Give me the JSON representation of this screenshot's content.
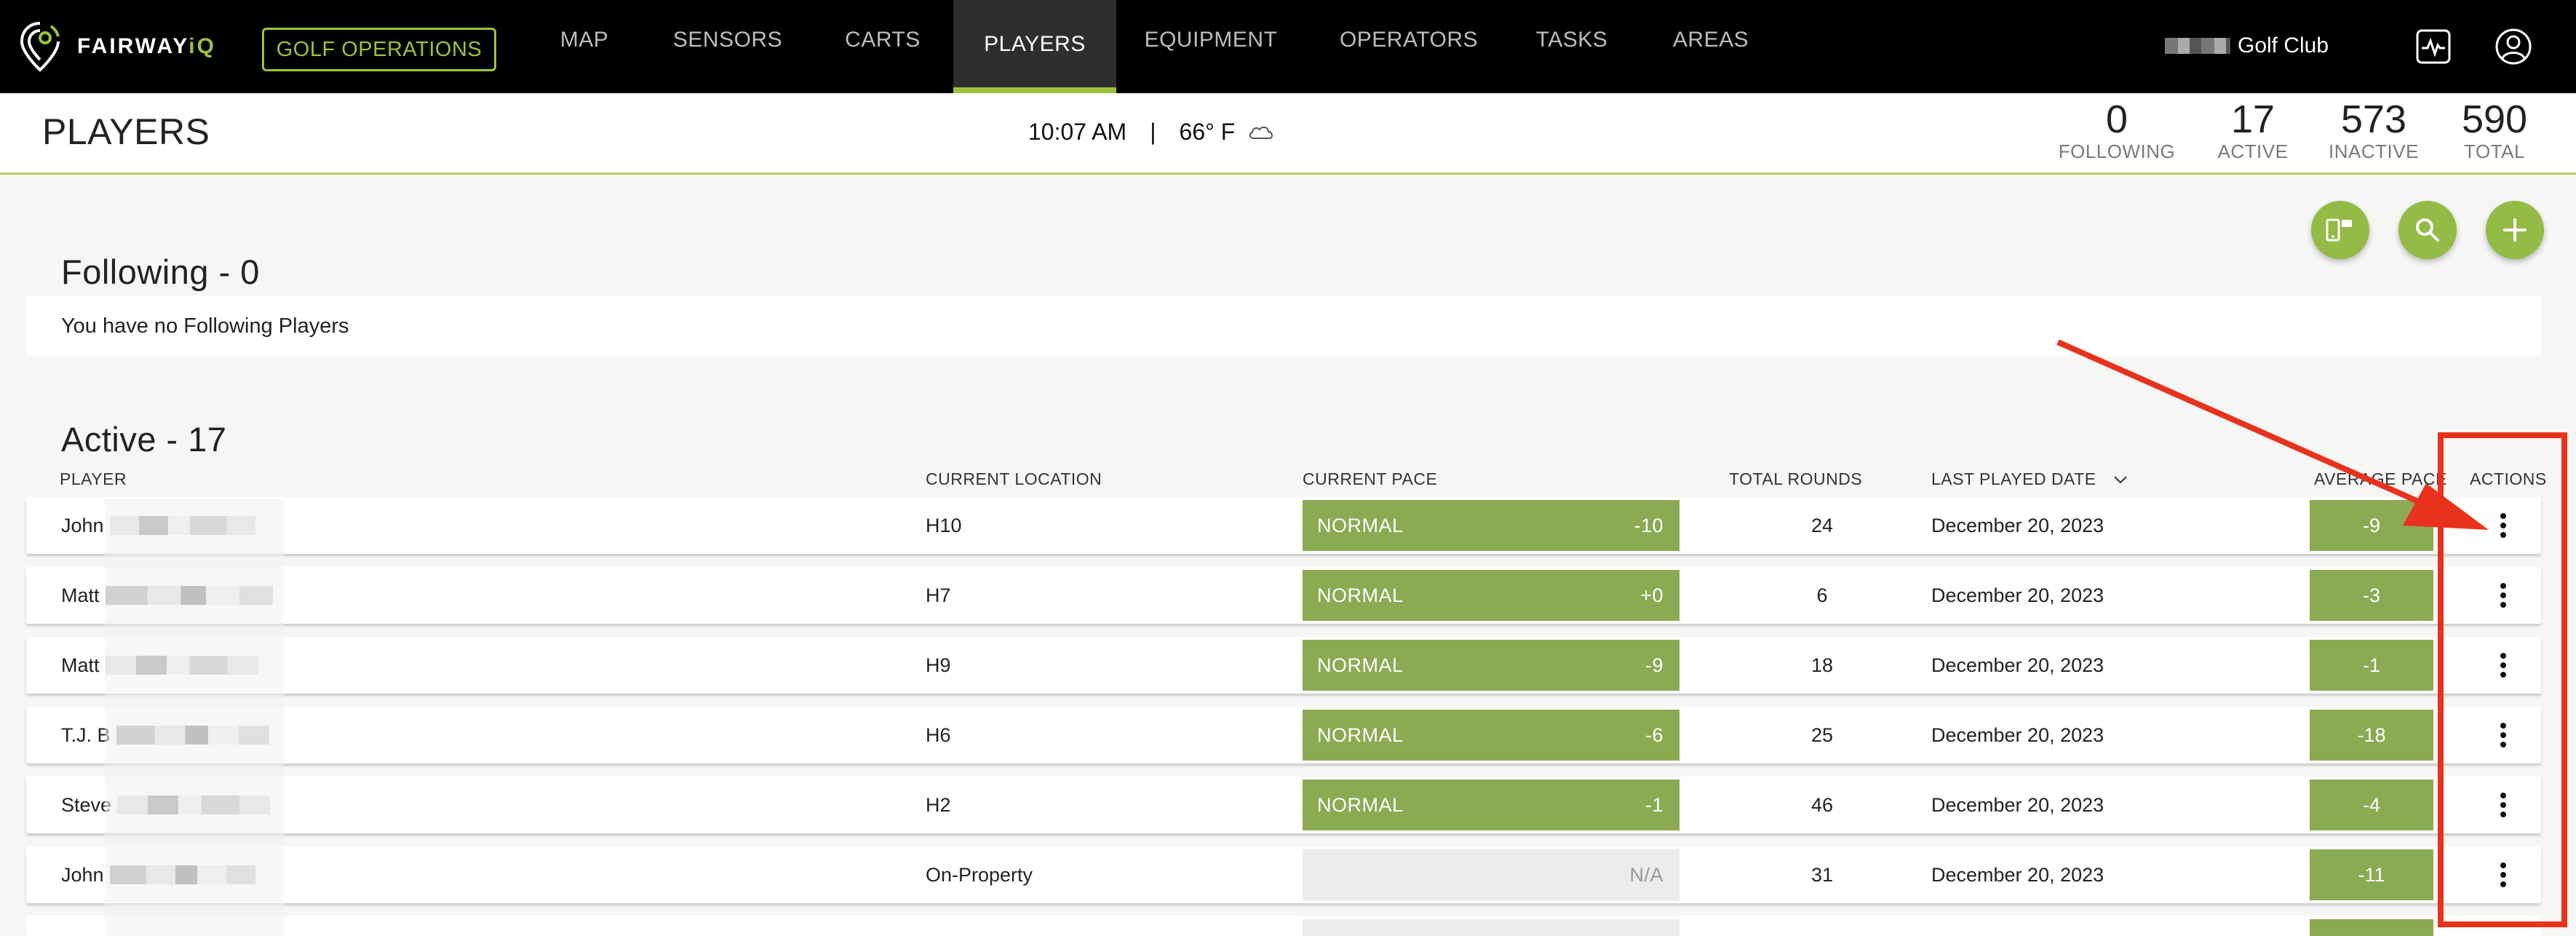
{
  "nav": {
    "logo_text_main": "FAIRWAY",
    "logo_text_accent": "iQ",
    "golf_operations": "GOLF OPERATIONS",
    "items": [
      {
        "label": "MAP"
      },
      {
        "label": "SENSORS"
      },
      {
        "label": "CARTS"
      },
      {
        "label": "PLAYERS",
        "active": true
      },
      {
        "label": "EQUIPMENT"
      },
      {
        "label": "OPERATORS"
      },
      {
        "label": "TASKS"
      },
      {
        "label": "AREAS"
      }
    ],
    "club_name": "Golf Club",
    "icons": [
      "pulse-monitor-icon",
      "user-account-icon"
    ]
  },
  "header": {
    "title": "PLAYERS",
    "time": "10:07 AM",
    "separator": "|",
    "temperature": "66° F",
    "weather_icon": "cloud-icon",
    "stats": [
      {
        "value": "0",
        "label": "FOLLOWING"
      },
      {
        "value": "17",
        "label": "ACTIVE"
      },
      {
        "value": "573",
        "label": "INACTIVE"
      },
      {
        "value": "590",
        "label": "TOTAL"
      }
    ]
  },
  "actions": [
    "device-pair-icon",
    "search-icon",
    "add-icon"
  ],
  "following": {
    "title": "Following - 0",
    "empty_message": "You have no Following Players"
  },
  "active": {
    "title": "Active - 17",
    "columns": {
      "player": "PLAYER",
      "location": "CURRENT LOCATION",
      "pace": "CURRENT PACE",
      "rounds": "TOTAL ROUNDS",
      "last_played": "LAST PLAYED DATE",
      "avg_pace": "AVERAGE PACE",
      "actions": "ACTIONS"
    },
    "rows": [
      {
        "player": "John",
        "location": "H10",
        "pace_status": "NORMAL",
        "pace_value": "-10",
        "rounds": "24",
        "last_played": "December 20, 2023",
        "avg_pace": "-9"
      },
      {
        "player": "Matt",
        "location": "H7",
        "pace_status": "NORMAL",
        "pace_value": "+0",
        "rounds": "6",
        "last_played": "December 20, 2023",
        "avg_pace": "-3"
      },
      {
        "player": "Matt",
        "location": "H9",
        "pace_status": "NORMAL",
        "pace_value": "-9",
        "rounds": "18",
        "last_played": "December 20, 2023",
        "avg_pace": "-1"
      },
      {
        "player": "T.J. B",
        "location": "H6",
        "pace_status": "NORMAL",
        "pace_value": "-6",
        "rounds": "25",
        "last_played": "December 20, 2023",
        "avg_pace": "-18"
      },
      {
        "player": "Steve",
        "location": "H2",
        "pace_status": "NORMAL",
        "pace_value": "-1",
        "rounds": "46",
        "last_played": "December 20, 2023",
        "avg_pace": "-4"
      },
      {
        "player": "John",
        "location": "On-Property",
        "pace_status": "",
        "pace_value": "N/A",
        "rounds": "31",
        "last_played": "December 20, 2023",
        "avg_pace": "-11"
      }
    ]
  },
  "colors": {
    "accent": "#9cc33b",
    "pace_green": "#8baa52",
    "annotation_red": "#e8321d"
  }
}
